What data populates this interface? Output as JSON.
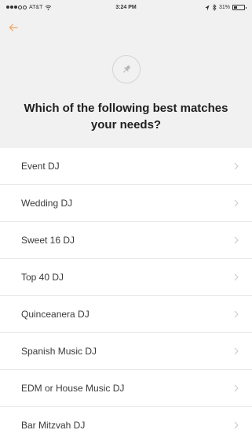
{
  "status_bar": {
    "carrier": "AT&T",
    "time": "3:24 PM",
    "battery": "31%",
    "battery_level": 0.31
  },
  "header": {
    "back_icon": "arrow-left-icon",
    "badge_icon": "pin-icon",
    "title": "Which of the following best matches your needs?"
  },
  "options": [
    {
      "label": "Event DJ"
    },
    {
      "label": "Wedding DJ"
    },
    {
      "label": "Sweet 16 DJ"
    },
    {
      "label": "Top 40 DJ"
    },
    {
      "label": "Quinceanera DJ"
    },
    {
      "label": "Spanish Music DJ"
    },
    {
      "label": "EDM or House Music DJ"
    },
    {
      "label": "Bar Mitzvah DJ"
    }
  ],
  "colors": {
    "accent": "#f0a155",
    "header_bg": "#f1f1f1",
    "divider": "#e6e6e6"
  }
}
